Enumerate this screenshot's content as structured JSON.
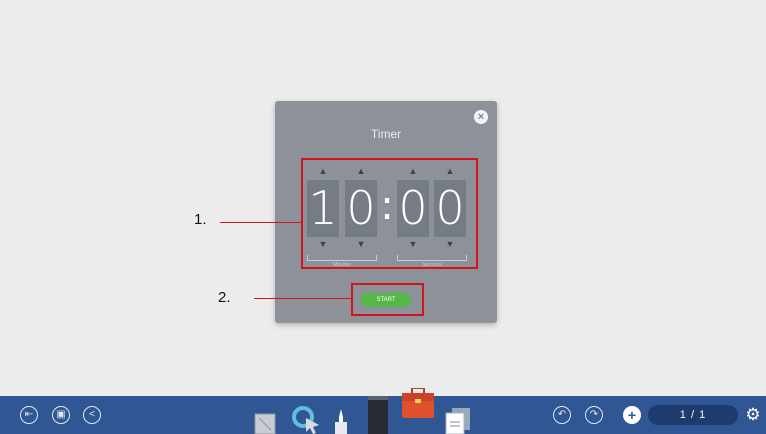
{
  "timer": {
    "title": "Timer",
    "digits": [
      "1",
      "0",
      "0",
      "0"
    ],
    "separator": ":",
    "minutes_label": "Minutes",
    "seconds_label": "Seconds",
    "start_label": "START",
    "close_icon": "×"
  },
  "annotations": {
    "label_1": "1.",
    "label_2": "2."
  },
  "toolbar": {
    "page_indicator": "1 / 1",
    "exit_icon": "exit-icon",
    "save_icon": "save-icon",
    "share_icon": "share-icon",
    "undo_icon": "undo-icon",
    "redo_icon": "redo-icon",
    "add_page_icon": "plus-icon",
    "settings_icon": "gear-icon"
  },
  "colors": {
    "toolbar_bg": "#315694",
    "dialog_bg": "#8d929a",
    "start_green": "#56b947",
    "annotation_red": "#d3141c"
  }
}
